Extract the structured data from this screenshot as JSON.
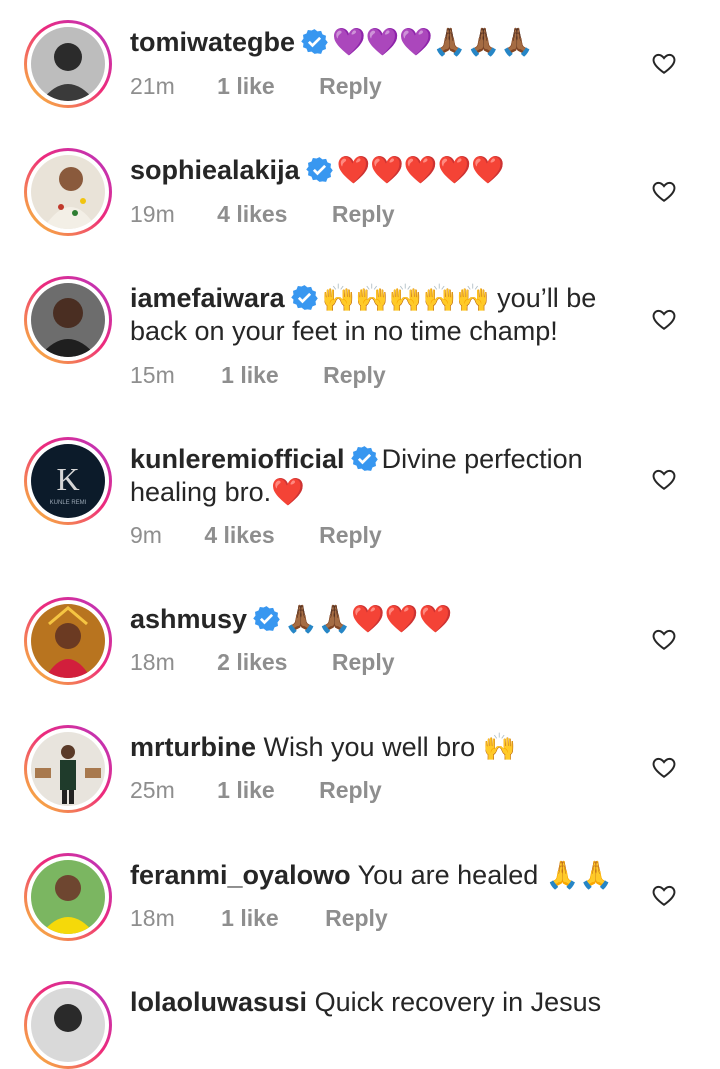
{
  "comments": [
    {
      "username": "tomiwategbe",
      "verified": true,
      "text": "💜💜💜🙏🏾🙏🏾🙏🏾",
      "time": "21m",
      "likes": "1 like",
      "reply": "Reply"
    },
    {
      "username": "sophiealakija",
      "verified": true,
      "text": "❤️❤️❤️❤️❤️",
      "time": "19m",
      "likes": "4 likes",
      "reply": "Reply"
    },
    {
      "username": "iamefaiwara",
      "verified": true,
      "text": "🙌🙌🙌🙌🙌 you’ll be back on your feet in no time champ!",
      "time": "15m",
      "likes": "1 like",
      "reply": "Reply"
    },
    {
      "username": "kunleremiofficial",
      "verified": true,
      "text": "Divine perfection healing bro.❤️",
      "time": "9m",
      "likes": "4 likes",
      "reply": "Reply"
    },
    {
      "username": "ashmusy",
      "verified": true,
      "text": "🙏🏾🙏🏾❤️❤️❤️",
      "time": "18m",
      "likes": "2 likes",
      "reply": "Reply"
    },
    {
      "username": "mrturbine",
      "verified": false,
      "text": "Wish you well bro 🙌",
      "time": "25m",
      "likes": "1 like",
      "reply": "Reply"
    },
    {
      "username": "feranmi_oyalowo",
      "verified": false,
      "text": "You are healed 🙏🙏",
      "time": "18m",
      "likes": "1 like",
      "reply": "Reply"
    },
    {
      "username": "lolaoluwasusi",
      "verified": false,
      "text": "Quick recovery in Jesus",
      "time": "",
      "likes": "",
      "reply": ""
    }
  ],
  "colors": {
    "verified": "#3897f0",
    "meta": "#8e8e8e",
    "text": "#262626"
  },
  "icons": {
    "verified": "verified-badge-icon",
    "like": "heart-outline-icon"
  }
}
